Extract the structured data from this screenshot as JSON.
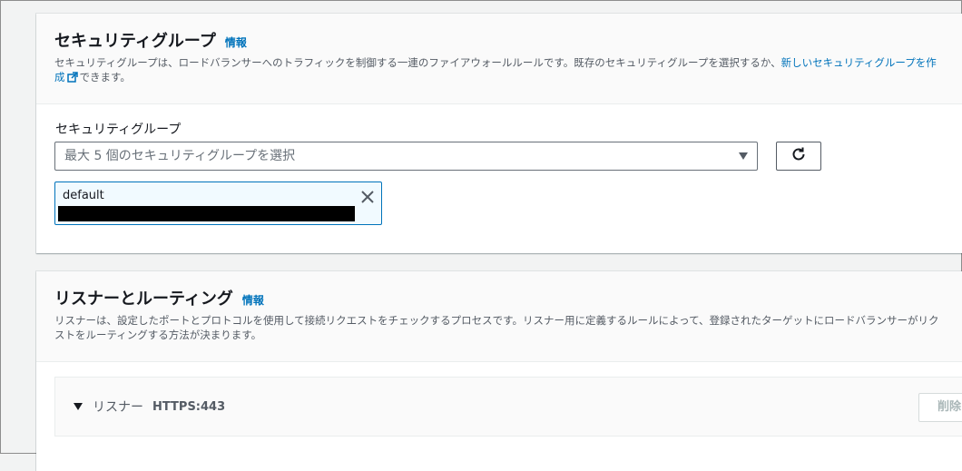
{
  "security_group": {
    "title": "セキュリティグループ",
    "info": "情報",
    "desc_line1_text": "セキュリティグループは、ロードバランサーへのトラフィックを制御する一連のファイアウォールルールです。既存のセキュリティグループを選択するか、",
    "desc_link": "新しいセキュリティグループを作",
    "desc_line2_link": "成",
    "desc_line2_text": "できます。",
    "field_label": "セキュリティグループ",
    "select_placeholder": "最大 5 個のセキュリティグループを選択",
    "selected_token": {
      "label": "default"
    }
  },
  "listeners": {
    "title": "リスナーとルーティング",
    "info": "情報",
    "desc_line1": "リスナーは、設定したポートとプロトコルを使用して接続リクエストをチェックするプロセスです。リスナー用に定義するルールによって、登録されたターゲットにロードバランサーがリク",
    "desc_line2": "ストをルーティングする方法が決まります。",
    "listener": {
      "label": "リスナー",
      "port": "HTTPS:443",
      "remove_button": "削除"
    }
  },
  "icons": {
    "external_link": "external-link-icon",
    "refresh": "refresh-icon",
    "dismiss": "close-icon",
    "caret": "caret-down-icon",
    "expand": "expand-triangle-icon"
  },
  "colors": {
    "link": "#0073bb",
    "token_bg": "#f1faff",
    "token_border": "#0073bb"
  }
}
